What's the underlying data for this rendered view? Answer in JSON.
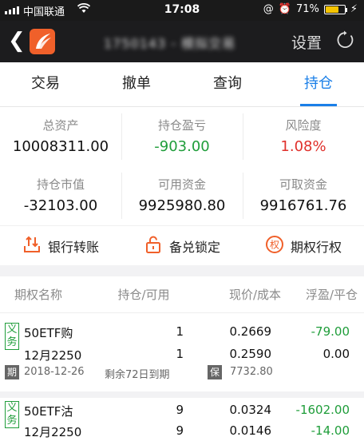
{
  "status_bar": {
    "carrier": "中国联通",
    "time": "17:08",
    "battery": "71%",
    "battery_level": 0.71
  },
  "nav": {
    "title": "1750143 - 模拟交易",
    "settings_label": "设置"
  },
  "tabs": [
    {
      "label": "交易"
    },
    {
      "label": "撤单"
    },
    {
      "label": "查询"
    },
    {
      "label": "持仓"
    }
  ],
  "summary": {
    "total_assets": {
      "label": "总资产",
      "value": "10008311.00"
    },
    "position_pl": {
      "label": "持仓盈亏",
      "value": "-903.00"
    },
    "risk": {
      "label": "风险度",
      "value": "1.08%"
    },
    "position_value": {
      "label": "持仓市值",
      "value": "-32103.00"
    },
    "available_funds": {
      "label": "可用资金",
      "value": "9925980.80"
    },
    "withdrawable_funds": {
      "label": "可取资金",
      "value": "9916761.76"
    }
  },
  "actions": [
    {
      "label": "银行转账",
      "icon": "bank-transfer-icon"
    },
    {
      "label": "备兑锁定",
      "icon": "lock-icon"
    },
    {
      "label": "期权行权",
      "icon": "exercise-icon"
    }
  ],
  "table": {
    "headers": [
      "期权名称",
      "持仓/可用",
      "现价/成本",
      "浮盈/平仓"
    ],
    "rows": [
      {
        "badge": [
          "义",
          "务"
        ],
        "name": "50ETF购",
        "month": "12月2250",
        "position": "1",
        "available": "1",
        "price": "0.2669",
        "cost": "0.2590",
        "float_pl": "-79.00",
        "close_pl": "0.00",
        "period_tag": "期",
        "expiry": "2018-12-26",
        "remaining": "剩余72日到期",
        "margin_tag": "保",
        "margin": "7732.80"
      },
      {
        "badge": [
          "义",
          "务"
        ],
        "name": "50ETF沽",
        "month": "12月2250",
        "position": "9",
        "available": "9",
        "price": "0.0324",
        "cost": "0.0146",
        "float_pl": "-1602.00",
        "close_pl": "-14.00"
      }
    ]
  },
  "colors": {
    "accent": "#1a7fe8",
    "gain": "#1f9d3a",
    "loss": "#e0302b",
    "action_icon": "#f0602a"
  }
}
